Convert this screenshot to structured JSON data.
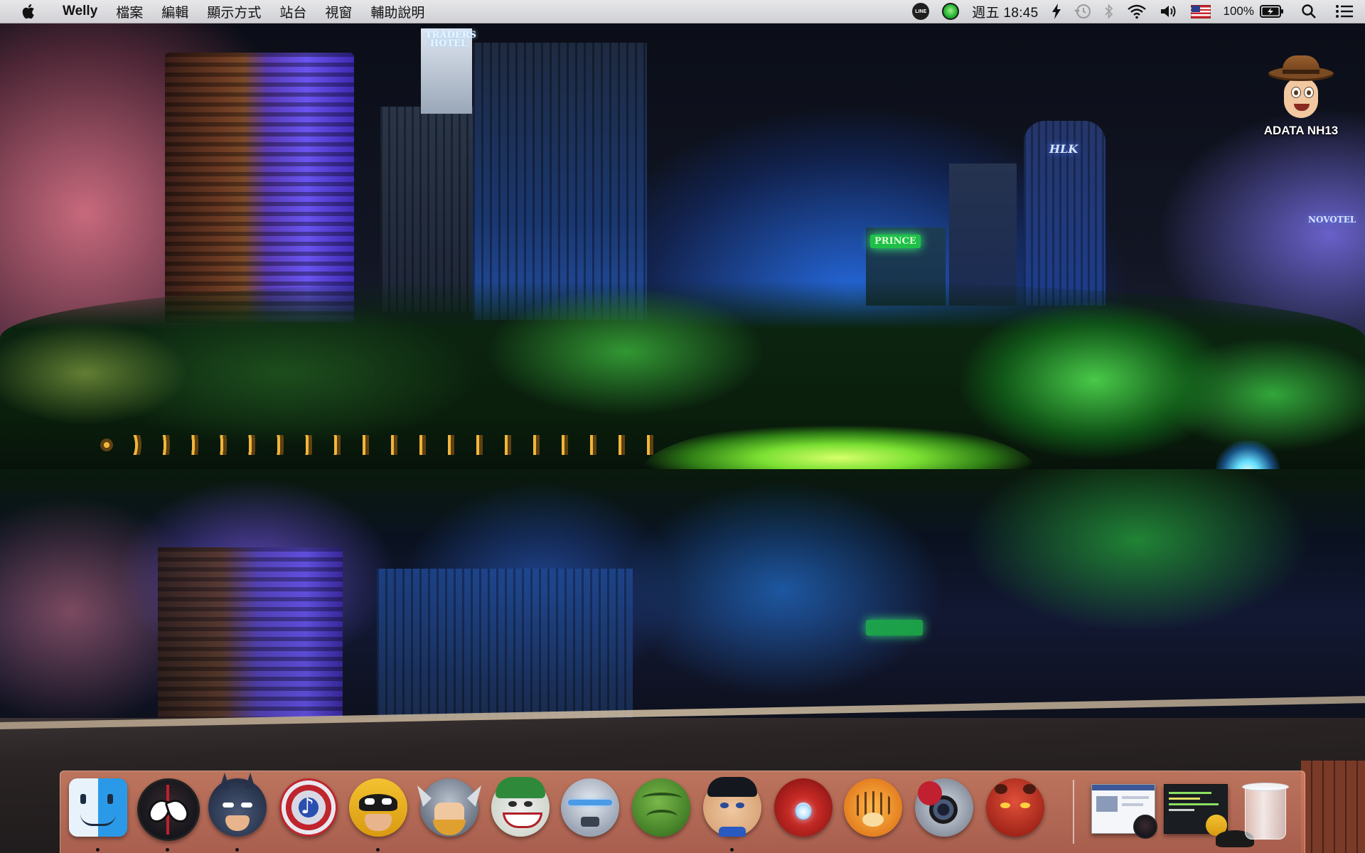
{
  "menubar": {
    "app_name": "Welly",
    "menus": [
      "檔案",
      "編輯",
      "顯示方式",
      "站台",
      "視窗",
      "輔助說明"
    ],
    "status": {
      "line_label": "LINE",
      "clock": "週五 18:45",
      "battery_percent": "100%",
      "icons": [
        "line-icon",
        "green-status-icon",
        "power-flash-icon",
        "time-machine-icon",
        "bluetooth-icon",
        "wifi-icon",
        "volume-icon",
        "us-flag-icon",
        "battery-icon",
        "spotlight-search-icon",
        "notification-center-icon"
      ]
    }
  },
  "desktop": {
    "drive_label": "ADATA NH13",
    "wallpaper_signs": {
      "traders": "TRADERS HOTEL",
      "prince": "PRINCE",
      "hlk": "HLK",
      "novotel": "NOVOTEL"
    }
  },
  "dock": {
    "apps": [
      {
        "name": "finder-icon",
        "running": true
      },
      {
        "name": "spiderman-icon",
        "running": true
      },
      {
        "name": "batman-icon",
        "running": true
      },
      {
        "name": "captain-america-shield-icon",
        "running": false
      },
      {
        "name": "wolverine-icon",
        "running": true
      },
      {
        "name": "thor-icon",
        "running": false
      },
      {
        "name": "joker-icon",
        "running": false
      },
      {
        "name": "iron-patriot-icon",
        "running": false
      },
      {
        "name": "hulk-fist-icon",
        "running": false
      },
      {
        "name": "superman-icon",
        "running": true
      },
      {
        "name": "iron-man-hand-icon",
        "running": false
      },
      {
        "name": "tigger-icon",
        "running": false
      },
      {
        "name": "spiderman-camera-icon",
        "running": false
      },
      {
        "name": "hellboy-icon",
        "running": false
      }
    ],
    "minimized_windows": [
      "browser-window-thumbnail",
      "terminal-window-thumbnail"
    ],
    "trash": "trash-icon",
    "colors": {
      "dock_bg": "#d88a70",
      "accent": "#2a9ae8"
    }
  }
}
